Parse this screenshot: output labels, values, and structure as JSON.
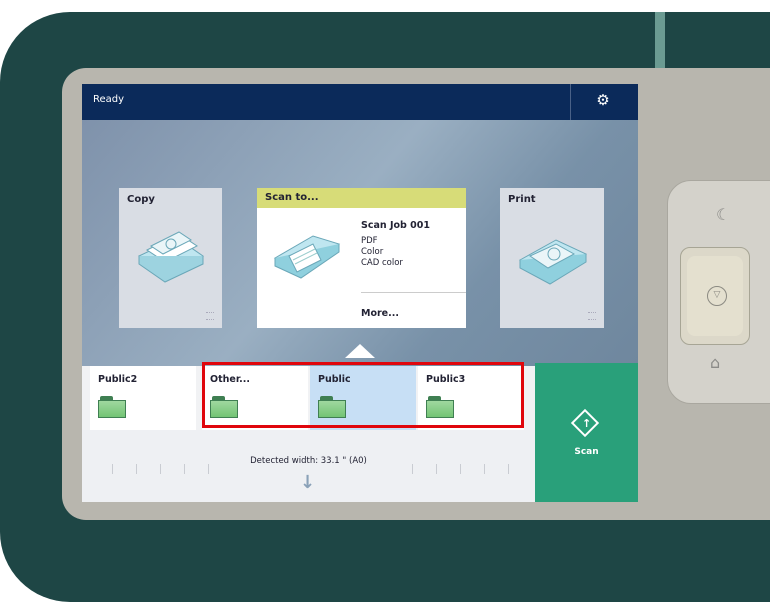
{
  "status": {
    "text": "Ready"
  },
  "tiles": {
    "copy": {
      "title": "Copy"
    },
    "scan": {
      "title": "Scan to...",
      "job": "Scan Job 001",
      "format": "PDF",
      "color": "Color",
      "profile": "CAD color",
      "more": "More..."
    },
    "print": {
      "title": "Print"
    }
  },
  "folders": [
    {
      "name": "Public2"
    },
    {
      "name": "Other..."
    },
    {
      "name": "Public"
    },
    {
      "name": "Public3"
    }
  ],
  "scan_button": {
    "label": "Scan"
  },
  "detected": {
    "text": "Detected width: 33.1 \" (A0)"
  },
  "icons": {
    "settings": "gear-icon",
    "scan": "scan-diamond-icon",
    "sleep": "moon-icon",
    "stop": "stop-icon",
    "home": "home-icon"
  },
  "colors": {
    "statusbar": "#0b2a5a",
    "scan_accent": "#29a07a",
    "scan_header": "#d7dc78",
    "selected_folder": "#c7dff5",
    "highlight": "#e0060c"
  }
}
